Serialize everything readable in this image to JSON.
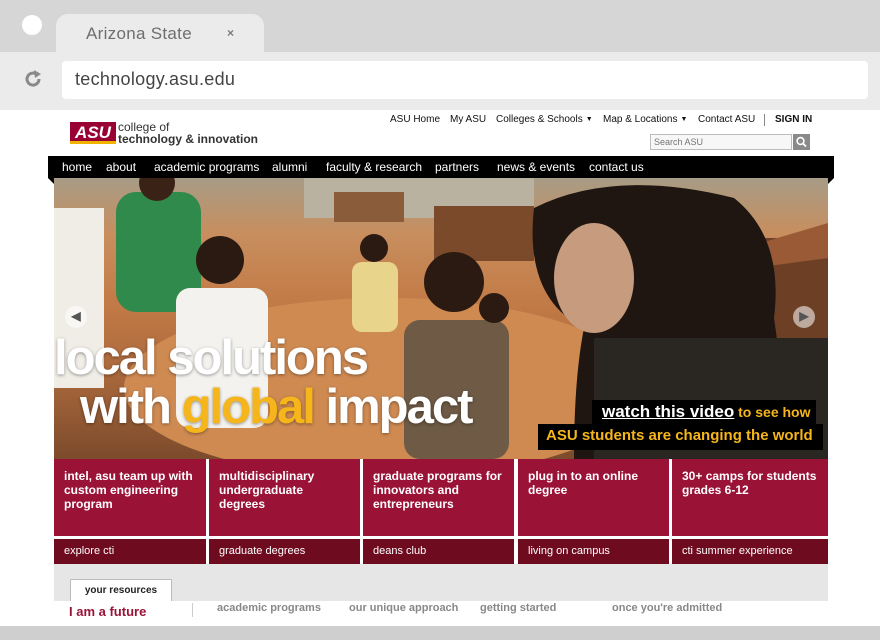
{
  "browser": {
    "tab_title": "Arizona State",
    "tab_close": "×",
    "url": "technology.asu.edu"
  },
  "header": {
    "logo": {
      "mark": "ASU",
      "line1": "college of",
      "line2": "technology & innovation"
    },
    "top_links": [
      {
        "label": "ASU Home"
      },
      {
        "label": "My ASU"
      },
      {
        "label": "Colleges & Schools"
      },
      {
        "label": "Map & Locations"
      },
      {
        "label": "Contact ASU"
      },
      {
        "label": "SIGN IN"
      }
    ],
    "search": {
      "placeholder": "Search ASU"
    }
  },
  "main_nav": [
    {
      "label": "home"
    },
    {
      "label": "about"
    },
    {
      "label": "academic programs"
    },
    {
      "label": "alumni"
    },
    {
      "label": "faculty & research"
    },
    {
      "label": "partners"
    },
    {
      "label": "news & events"
    },
    {
      "label": "contact us"
    }
  ],
  "hero": {
    "line1": "local solutions",
    "line2_a": "with ",
    "line2_b": "global",
    "line2_c": " impact",
    "cta_link": "watch this video",
    "cta_rest": " to see how",
    "cta_line2": "ASU students are changing the world",
    "prev_arrow": "◀",
    "next_arrow": "▶"
  },
  "promos": [
    {
      "text": "intel, asu team up with custom engineering program",
      "link": "explore cti"
    },
    {
      "text": "multidisciplinary undergraduate degrees",
      "link": "graduate degrees"
    },
    {
      "text": "graduate programs for innovators and entrepreneurs",
      "link": "deans club"
    },
    {
      "text": "plug in to an online degree",
      "link": "living on campus"
    },
    {
      "text": "30+ camps for students grades 6-12",
      "link": "cti summer experience"
    }
  ],
  "resources": {
    "tab_label": "your resources",
    "heading": "I am a future",
    "links": [
      "academic programs",
      "our unique approach",
      "getting started",
      "once you're admitted"
    ]
  },
  "colors": {
    "maroon": "#9b1237",
    "dark_maroon": "#6e0b1f",
    "gold": "#f5b51b"
  }
}
